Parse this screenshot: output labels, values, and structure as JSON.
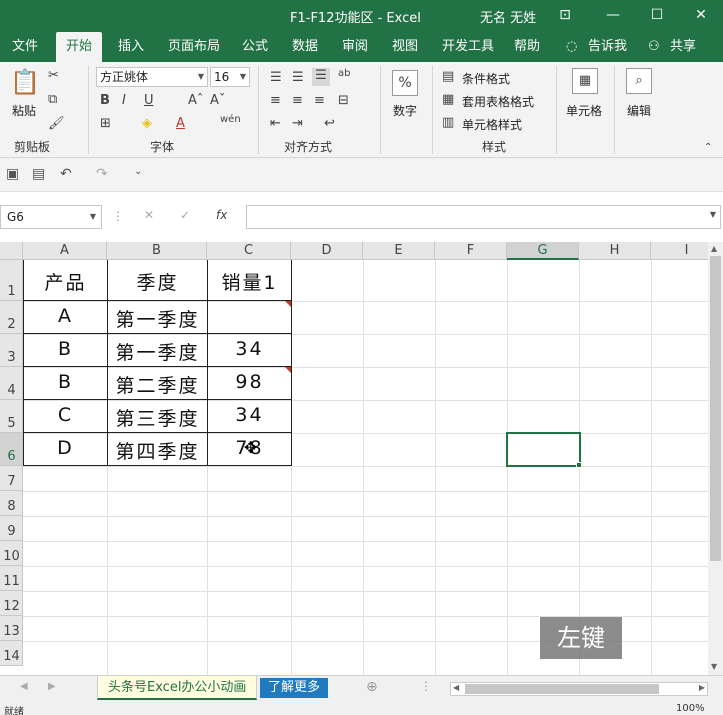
{
  "window": {
    "title": "F1-F12功能区  -  Excel",
    "user": "无名 无姓"
  },
  "ribbon_tabs": [
    "文件",
    "开始",
    "插入",
    "页面布局",
    "公式",
    "数据",
    "审阅",
    "视图",
    "开发工具",
    "帮助"
  ],
  "tell_me": "告诉我",
  "share": "共享",
  "ribbon": {
    "paste": "粘贴",
    "clipboard_group": "剪贴板",
    "font_name": "方正姚体",
    "font_size": "16",
    "font_group": "字体",
    "align_group": "对齐方式",
    "number_label": "数字",
    "number_symbol": "%",
    "styles": {
      "conditional": "条件格式",
      "table": "套用表格格式",
      "cell": "单元格样式"
    },
    "styles_group": "样式",
    "cells_label": "单元格",
    "edit_label": "编辑"
  },
  "formula_bar": {
    "name_box": "G6",
    "fx": "fx",
    "value": ""
  },
  "columns": [
    "A",
    "B",
    "C",
    "D",
    "E",
    "F",
    "G",
    "H",
    "I"
  ],
  "selected_column": "G",
  "rows": [
    "1",
    "2",
    "3",
    "4",
    "5",
    "6",
    "7",
    "8",
    "9",
    "10",
    "11",
    "12",
    "13",
    "14"
  ],
  "selected_row": "6",
  "table": {
    "header": [
      "产品",
      "季度",
      "销量1"
    ],
    "rows": [
      [
        "A",
        "第一季度",
        ""
      ],
      [
        "B",
        "第一季度",
        "34"
      ],
      [
        "B",
        "第二季度",
        "98"
      ],
      [
        "C",
        "第三季度",
        "34"
      ],
      [
        "D",
        "第四季度",
        "78"
      ]
    ]
  },
  "key_hint": "左键",
  "sheets": [
    "头条号Excel办公小动画",
    "了解更多"
  ],
  "status": {
    "ready": "就绪",
    "zoom": "100%"
  }
}
